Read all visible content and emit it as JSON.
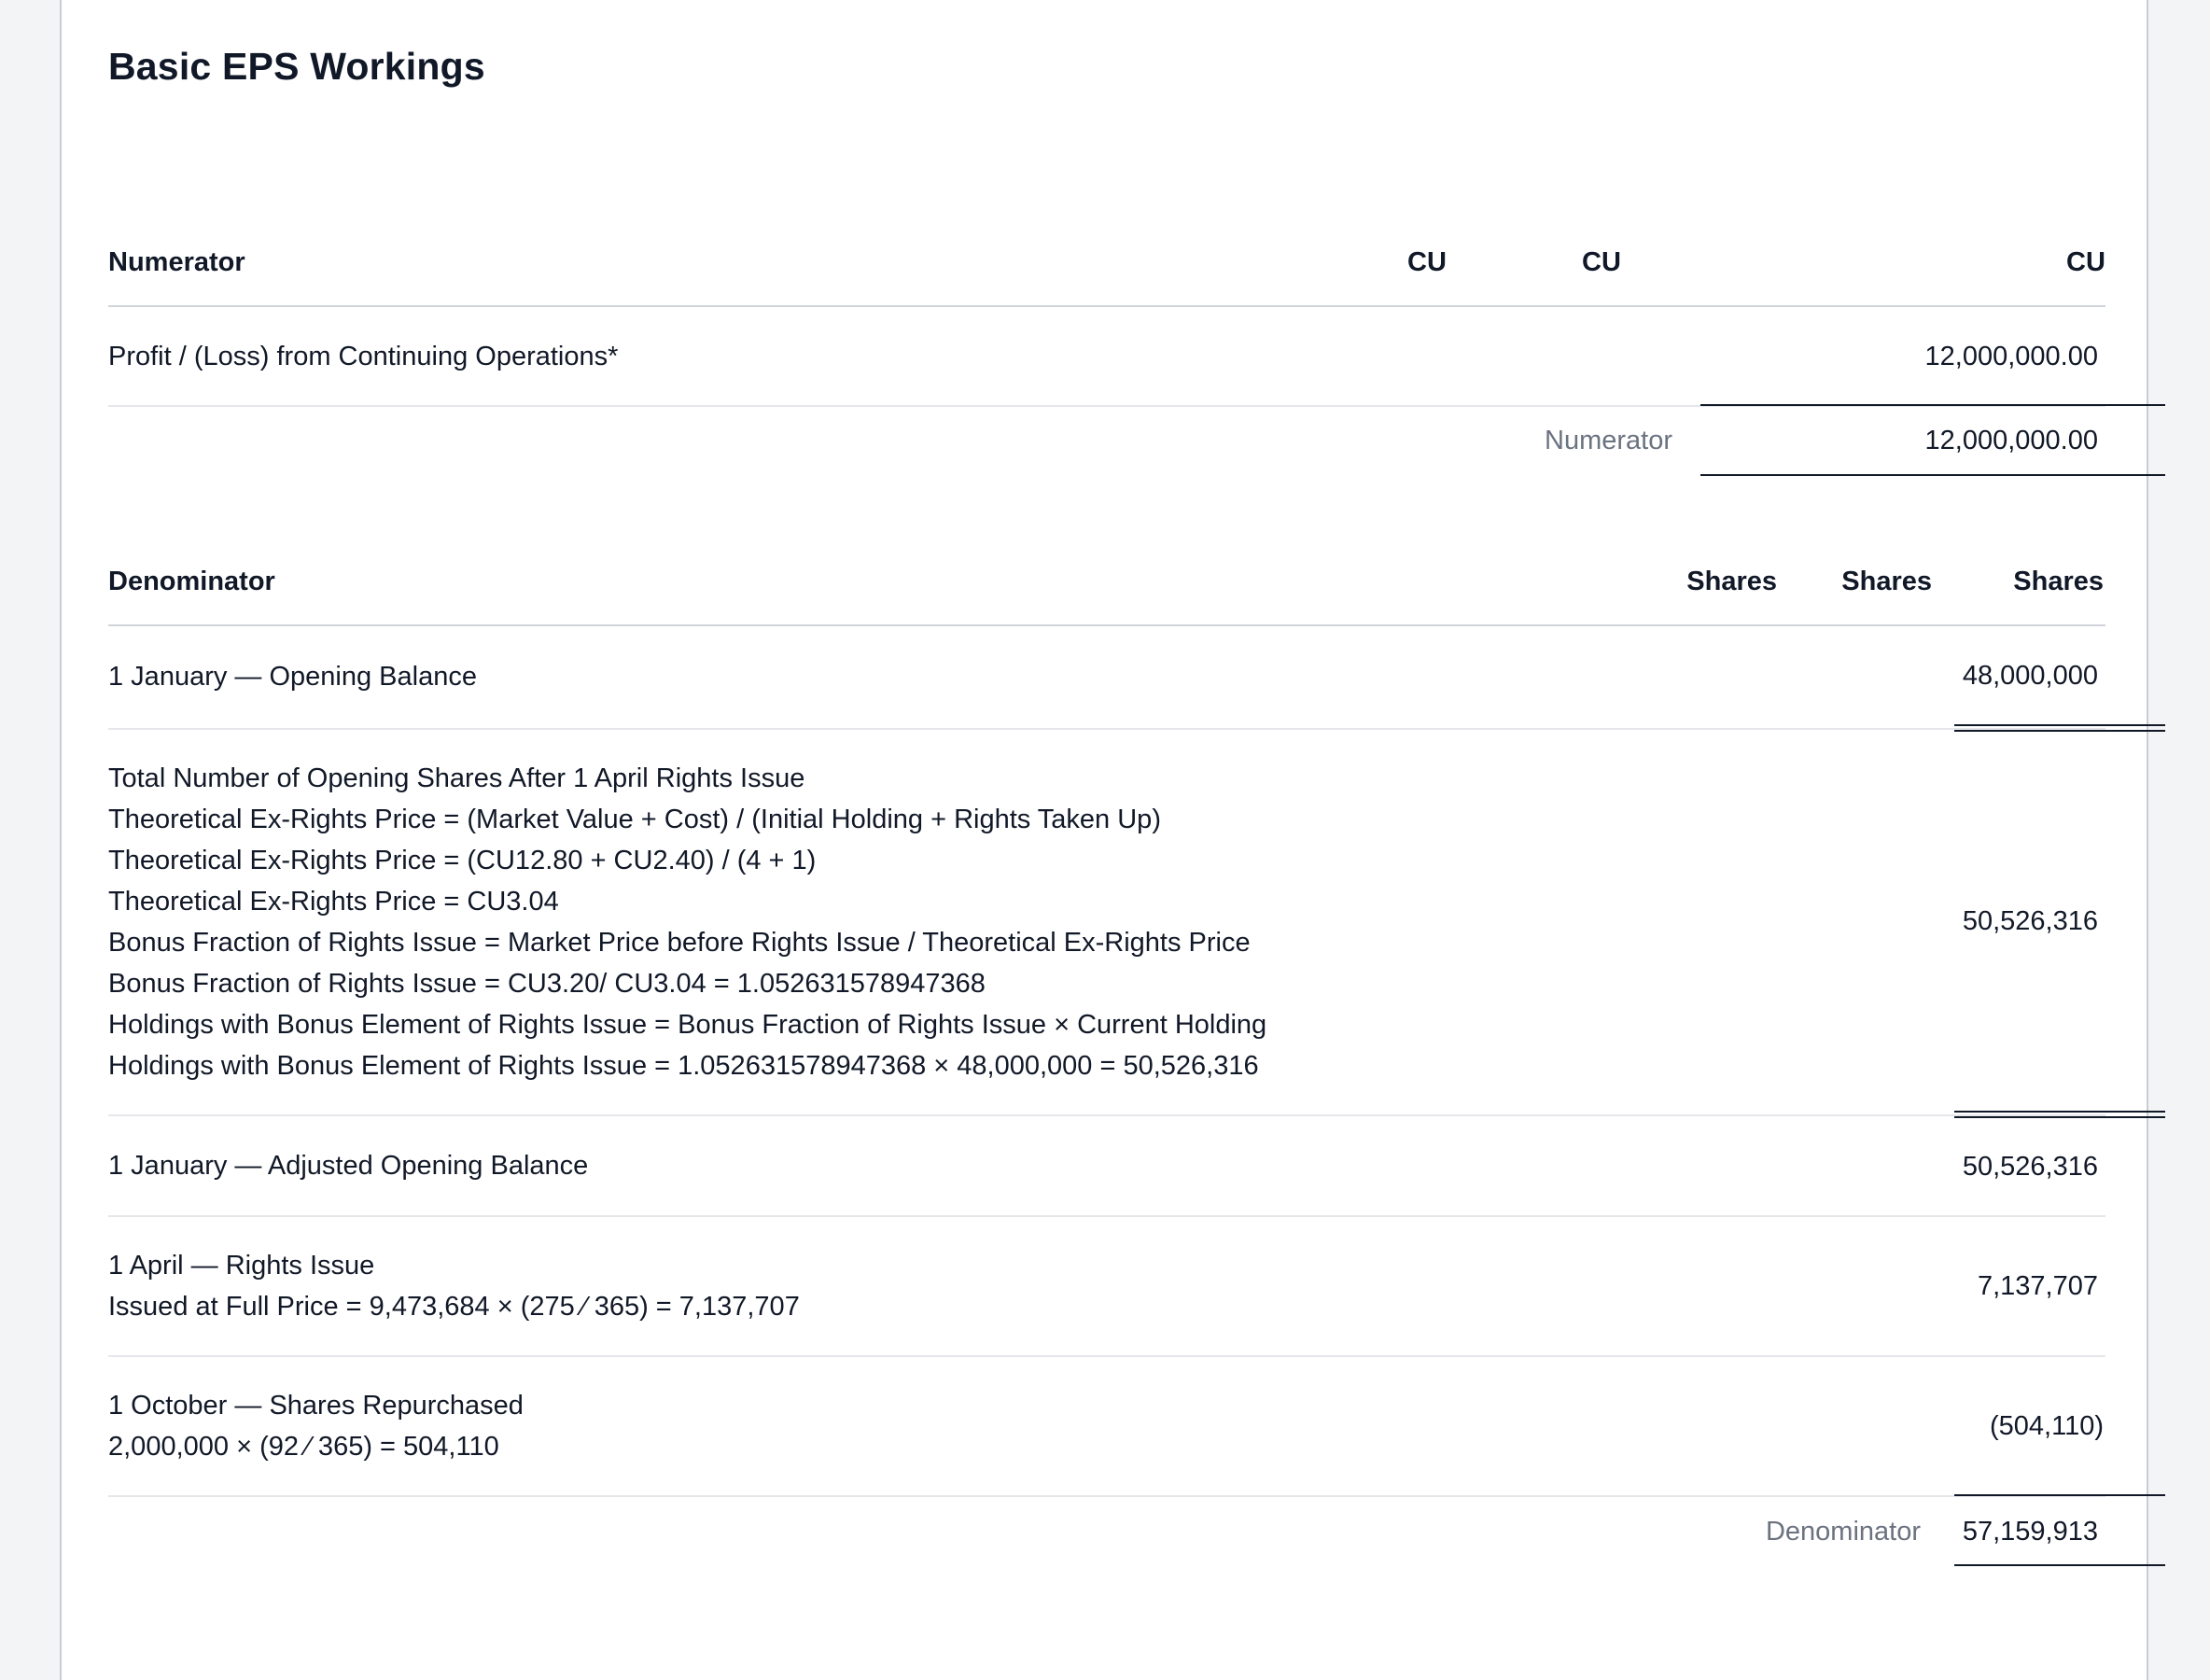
{
  "title": "Basic EPS Workings",
  "numerator": {
    "header": {
      "label": "Numerator",
      "col1": "CU",
      "col2": "CU",
      "col3": "CU"
    },
    "rows": [
      {
        "label": "Profit / (Loss) from Continuing Operations*",
        "value": "12,000,000.00"
      }
    ],
    "total": {
      "label": "Numerator",
      "value": "12,000,000.00"
    }
  },
  "denominator": {
    "header": {
      "label": "Denominator",
      "col1": "Shares",
      "col2": "Shares",
      "col3": "Shares"
    },
    "opening": {
      "label": "1 January — Opening Balance",
      "value": "48,000,000"
    },
    "rights_calc": {
      "lines": [
        "Total Number of Opening Shares After 1 April Rights Issue",
        "Theoretical Ex-Rights Price = (Market Value + Cost) / (Initial Holding + Rights Taken Up)",
        "Theoretical Ex-Rights Price = (CU12.80 + CU2.40) / (4 + 1)",
        "Theoretical Ex-Rights Price = CU3.04",
        "Bonus Fraction of Rights Issue = Market Price before Rights Issue / Theoretical Ex-Rights Price",
        "Bonus Fraction of Rights Issue = CU3.20/ CU3.04 = 1.052631578947368",
        "Holdings with Bonus Element of Rights Issue = Bonus Fraction of Rights Issue × Current Holding",
        "Holdings with Bonus Element of Rights Issue = 1.052631578947368 × 48,000,000 = 50,526,316"
      ],
      "value": "50,526,316"
    },
    "adjusted_opening": {
      "label": "1 January — Adjusted Opening Balance",
      "value": "50,526,316"
    },
    "rights_issue": {
      "label": "1 April — Rights Issue",
      "detail": "Issued at Full Price = 9,473,684 × (275 ⁄ 365) = 7,137,707",
      "value": "7,137,707"
    },
    "repurchase": {
      "label": "1 October — Shares Repurchased",
      "detail": "2,000,000 × (92 ⁄ 365) = 504,110",
      "value": "(504,110)"
    },
    "total": {
      "label": "Denominator",
      "value": "57,159,913"
    }
  }
}
